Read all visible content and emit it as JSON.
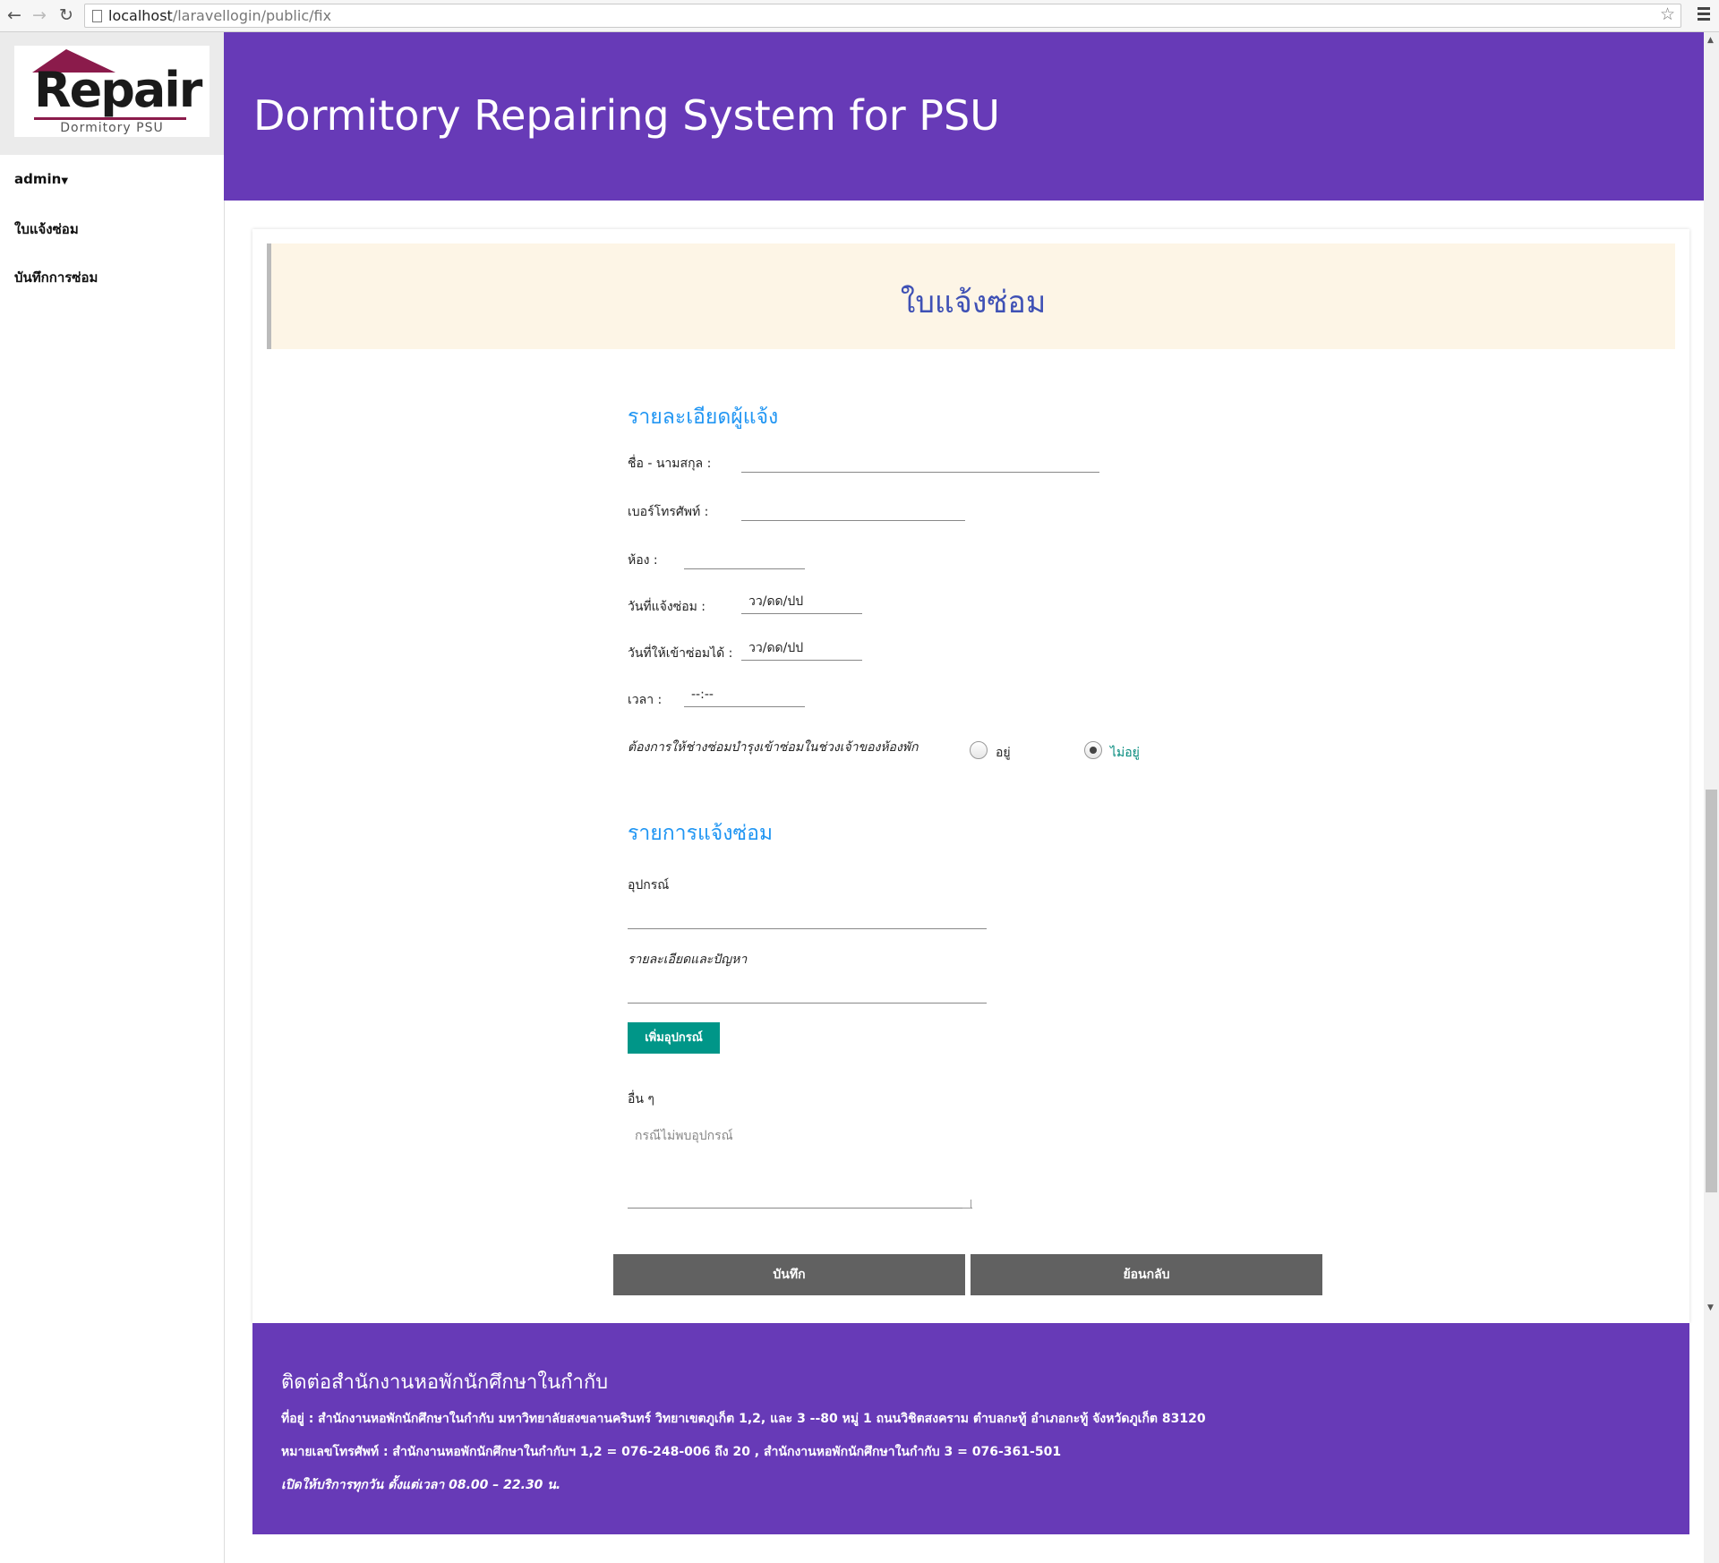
{
  "browser": {
    "url_host": "localhost",
    "url_path": "/laravellogin/public/fix"
  },
  "logo": {
    "word": "Repair",
    "subtitle": "Dormitory PSU"
  },
  "sidebar": {
    "user": "admin",
    "items": [
      {
        "label": "ใบแจ้งซ่อม"
      },
      {
        "label": "บันทึกการซ่อม"
      }
    ]
  },
  "header": {
    "title": "Dormitory Repairing System for PSU"
  },
  "form": {
    "banner_title": "ใบแจ้งซ่อม",
    "section1_title": "รายละเอียดผู้แจ้ง",
    "name_label": "ชื่อ - นามสกุล :",
    "phone_label": "เบอร์โทรศัพท์ :",
    "room_label": "ห้อง :",
    "report_date_label": "วันที่แจ้งซ่อม :",
    "report_date_value": "วว/ดด/ปป",
    "access_date_label": "วันที่ให้เข้าซ่อมได้ :",
    "access_date_value": "วว/ดด/ปป",
    "time_label": "เวลา :",
    "time_value": "--:--",
    "presence_question": "ต้องการให้ช่างซ่อมบำรุงเข้าซ่อมในช่วงเจ้าของห้องพัก",
    "presence_options": [
      {
        "label": "อยู่",
        "selected": false
      },
      {
        "label": "ไม่อยู่",
        "selected": true
      }
    ],
    "section2_title": "รายการแจ้งซ่อม",
    "equipment_label": "อุปกรณ์",
    "detail_label": "รายละเอียดและปัญหา",
    "add_button": "เพิ่มอุปกรณ์",
    "other_label": "อื่น ๆ",
    "other_placeholder": "กรณีไม่พบอุปกรณ์",
    "save_button": "บันทึก",
    "back_button": "ย้อนกลับ"
  },
  "footer": {
    "title": "ติดต่อสำนักงานหอพักนักศึกษาในกำกับ",
    "address": "ที่อยู่ : สำนักงานหอพักนักศึกษาในกำกับ มหาวิทยาลัยสงขลานครินทร์ วิทยาเขตภูเก็ต 1,2, และ 3 --80 หมู่ 1 ถนนวิชิตสงคราม ตำบลกะทู้ อำเภอกะทู้ จังหวัดภูเก็ต 83120",
    "phone": "หมายเลขโทรศัพท์ : สำนักงานหอพักนักศึกษาในกำกับฯ 1,2 = 076-248-006 ถึง 20 , สำนักงานหอพักนักศึกษาในกำกับ 3 = 076-361-501",
    "hours": "เปิดให้บริการทุกวัน ตั้งแต่เวลา 08.00 – 22.30 น."
  },
  "colors": {
    "header": "#673ab7",
    "banner": "#fdf5e6",
    "accent_title": "#3f51b5",
    "section_title": "#2196f3",
    "add_button": "#009688",
    "action_button": "#616161"
  }
}
